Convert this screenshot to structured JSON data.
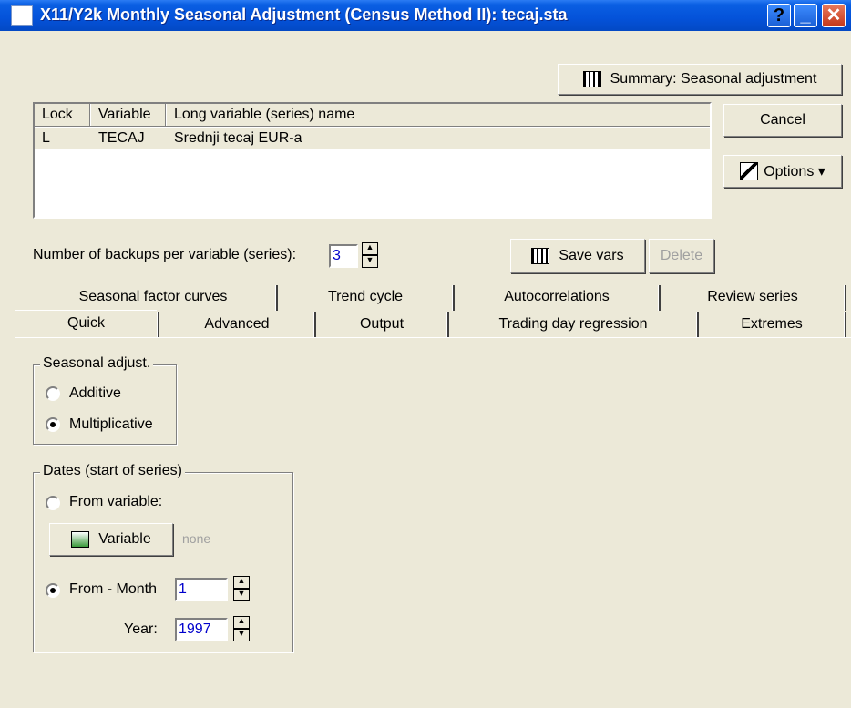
{
  "window": {
    "title": "X11/Y2k Monthly Seasonal Adjustment (Census Method II): tecaj.sta",
    "help": "?",
    "minimize": "_",
    "close": "✕"
  },
  "buttons": {
    "summary": "Summary:  Seasonal adjustment",
    "cancel": "Cancel",
    "options": "Options ▾",
    "save_vars": "Save vars",
    "delete": "Delete",
    "variable": "Variable"
  },
  "variables_list": {
    "headers": [
      "Lock",
      "Variable",
      "Long variable (series) name"
    ],
    "rows": [
      {
        "lock": "L",
        "variable": "TECAJ",
        "name": "Srednji tecaj EUR-a"
      }
    ]
  },
  "backups": {
    "label": "Number of backups per variable (series):",
    "value": "3"
  },
  "tabs": {
    "back_row": [
      "Seasonal factor curves",
      "Trend cycle",
      "Autocorrelations",
      "Review series"
    ],
    "front_row": [
      "Quick",
      "Advanced",
      "Output",
      "Trading day regression",
      "Extremes"
    ],
    "active": "Quick"
  },
  "seasonal_adjust": {
    "title": "Seasonal adjust.",
    "options": [
      "Additive",
      "Multiplicative"
    ],
    "selected": "Multiplicative"
  },
  "dates": {
    "title": "Dates (start of series)",
    "from_variable": "From variable:",
    "variable_value": "none",
    "from_month": "From - Month",
    "month_value": "1",
    "year_label": "Year:",
    "year_value": "1997",
    "selected": "From - Month"
  }
}
